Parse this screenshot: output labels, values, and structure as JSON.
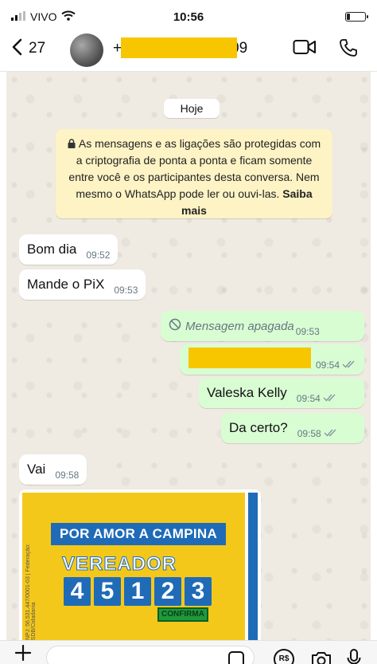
{
  "status_bar": {
    "carrier": "VIVO",
    "time": "10:56"
  },
  "header": {
    "back_count": "27",
    "contact_prefix": "+",
    "contact_suffix": "09"
  },
  "chat": {
    "date_chip": "Hoje",
    "encryption_notice": "As mensagens e as ligações são protegidas com a criptografia de ponta a ponta e ficam somente entre você e os participantes desta conversa. Nem mesmo o WhatsApp pode ler ou ouvi-las.",
    "encryption_link": "Saiba mais",
    "messages": [
      {
        "direction": "incoming",
        "text": "Bom dia",
        "time": "09:52"
      },
      {
        "direction": "incoming",
        "text": "Mande o PiX",
        "time": "09:53"
      },
      {
        "direction": "outgoing",
        "text": "Mensagem apagada",
        "time": "09:53",
        "deleted": true
      },
      {
        "direction": "outgoing",
        "text": "",
        "time": "09:54",
        "read": true
      },
      {
        "direction": "outgoing",
        "text": "Valeska Kelly",
        "time": "09:54",
        "read": true
      },
      {
        "direction": "outgoing",
        "text": "Da certo?",
        "time": "09:58",
        "read": true
      },
      {
        "direction": "incoming",
        "text": "Vai",
        "time": "09:58"
      }
    ],
    "image_message": {
      "banner": "POR AMOR A CAMPINA",
      "title": "VEREADOR",
      "number_digits": [
        "4",
        "5",
        "1",
        "2",
        "3"
      ],
      "confirm_label": "CONFIRMA",
      "side_text": "CNPJ: 56.531.447/0001-03 | Federação: PSDB/Cidadania"
    }
  },
  "composer": {
    "money_label": "R$"
  },
  "colors": {
    "chat_background": "#efeae2",
    "incoming_bubble": "#ffffff",
    "outgoing_bubble": "#d9fdd3",
    "notice_background": "#fdf3c5",
    "redaction": "#f7c600",
    "flyer_yellow": "#f4c81a",
    "flyer_blue": "#1f6bb7"
  }
}
